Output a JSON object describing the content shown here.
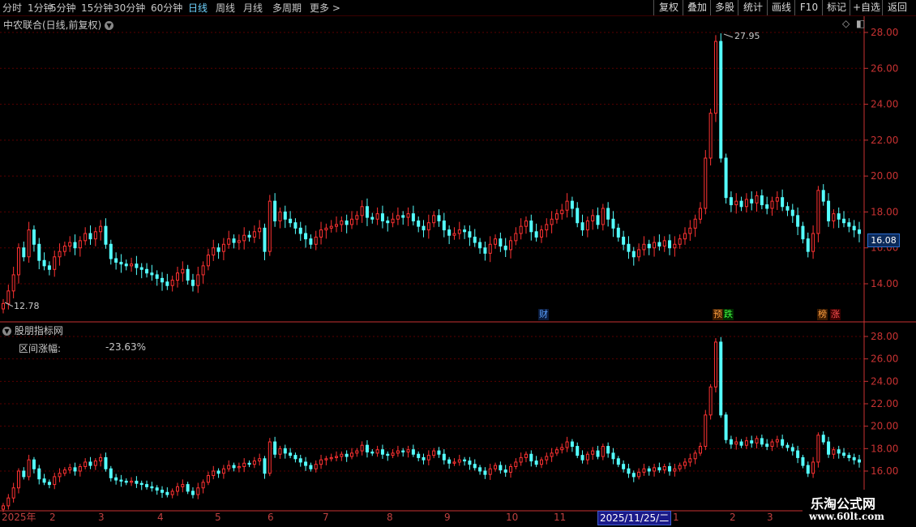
{
  "toolbar": {
    "timeframes": [
      "分时",
      "1分钟",
      "5分钟",
      "15分钟",
      "30分钟",
      "60分钟",
      "日线",
      "周线",
      "月线",
      "多周期",
      "更多"
    ],
    "active_timeframe": "日线",
    "more_arrow": ">",
    "right_buttons": [
      "复权",
      "叠加",
      "多股",
      "统计",
      "画线",
      "F10",
      "标记",
      "+自选",
      "返回"
    ]
  },
  "main_panel": {
    "title": "中农联合(日线,前复权)",
    "high_label": "27.95",
    "low_label": "12.78",
    "current_price": "16.08",
    "markers": [
      {
        "text": "财",
        "color": "#5aa0ff",
        "bg": "#0a1a3a"
      },
      {
        "text": "预",
        "color": "#ffa040",
        "bg": "#3a1a00"
      },
      {
        "text": "跌",
        "color": "#40ff40",
        "bg": "#002a00"
      },
      {
        "text": "榜",
        "color": "#ffa040",
        "bg": "#3a1a00"
      },
      {
        "text": "涨",
        "color": "#ff5050",
        "bg": "#3a0000"
      }
    ],
    "diamond_icon": "◇",
    "menu_icon": "◧"
  },
  "indicator_panel": {
    "title": "股朋指标网",
    "label": "区间涨幅:",
    "value": "-23.63%"
  },
  "date_axis": {
    "labels": [
      "2025年",
      "2",
      "3",
      "4",
      "5",
      "6",
      "7",
      "8",
      "9",
      "10",
      "11",
      "1",
      "2",
      "3"
    ],
    "selected": "2025/11/25/二"
  },
  "watermark": {
    "line1": "乐淘公式网",
    "line2": "www.60lt.com"
  },
  "colors": {
    "up": "#ff3232",
    "down": "#54ffff",
    "grid": "#5a0000",
    "axis": "#c83232",
    "bg": "#000000"
  },
  "chart_data": {
    "type": "candlestick",
    "price_axis_main": [
      14.0,
      16.0,
      18.0,
      20.0,
      22.0,
      24.0,
      26.0,
      28.0
    ],
    "price_axis_sub": [
      16.0,
      18.0,
      20.0,
      22.0,
      24.0,
      26.0,
      28.0
    ],
    "ylim": [
      12.0,
      28.6
    ],
    "high": 27.95,
    "low": 12.78,
    "last": 16.08,
    "closes": [
      12.9,
      13.6,
      14.5,
      16.0,
      15.5,
      17.0,
      16.2,
      15.3,
      15.0,
      14.8,
      15.5,
      15.8,
      16.1,
      16.3,
      16.0,
      16.4,
      16.8,
      16.5,
      16.9,
      17.2,
      16.2,
      15.4,
      15.2,
      15.1,
      15.0,
      15.1,
      14.9,
      14.8,
      14.6,
      14.5,
      14.3,
      14.1,
      13.9,
      14.2,
      14.6,
      14.8,
      14.2,
      13.9,
      14.5,
      15.0,
      15.6,
      16.0,
      15.8,
      16.2,
      16.5,
      16.3,
      16.4,
      16.7,
      16.6,
      16.9,
      17.1,
      15.8,
      18.6,
      17.5,
      18.0,
      17.6,
      17.4,
      17.1,
      16.8,
      16.5,
      16.2,
      16.6,
      17.0,
      17.1,
      17.2,
      17.3,
      17.5,
      17.3,
      17.6,
      17.8,
      18.3,
      17.7,
      17.6,
      17.9,
      17.5,
      17.4,
      17.6,
      17.8,
      17.7,
      17.9,
      17.5,
      17.2,
      17.0,
      17.4,
      17.8,
      17.5,
      17.0,
      16.7,
      16.8,
      17.0,
      16.9,
      16.6,
      16.3,
      16.0,
      15.7,
      16.2,
      16.5,
      16.1,
      15.9,
      16.4,
      16.8,
      17.2,
      17.5,
      16.9,
      16.6,
      17.0,
      17.3,
      17.6,
      17.9,
      18.1,
      18.6,
      18.2,
      17.4,
      17.0,
      17.5,
      17.8,
      17.3,
      18.2,
      17.6,
      17.1,
      16.6,
      16.2,
      15.8,
      15.5,
      15.9,
      16.2,
      16.0,
      16.3,
      16.1,
      16.4,
      16.0,
      16.2,
      16.5,
      16.8,
      17.1,
      17.6,
      18.2,
      21.0,
      23.5,
      27.5,
      21.0,
      18.8,
      18.4,
      18.6,
      18.3,
      18.7,
      18.5,
      18.9,
      18.4,
      18.2,
      18.6,
      18.8,
      18.3,
      18.1,
      17.8,
      17.2,
      16.5,
      15.8,
      16.8,
      19.2,
      18.6,
      17.5,
      17.9,
      17.6,
      17.4,
      17.2,
      17.0,
      16.8
    ]
  }
}
